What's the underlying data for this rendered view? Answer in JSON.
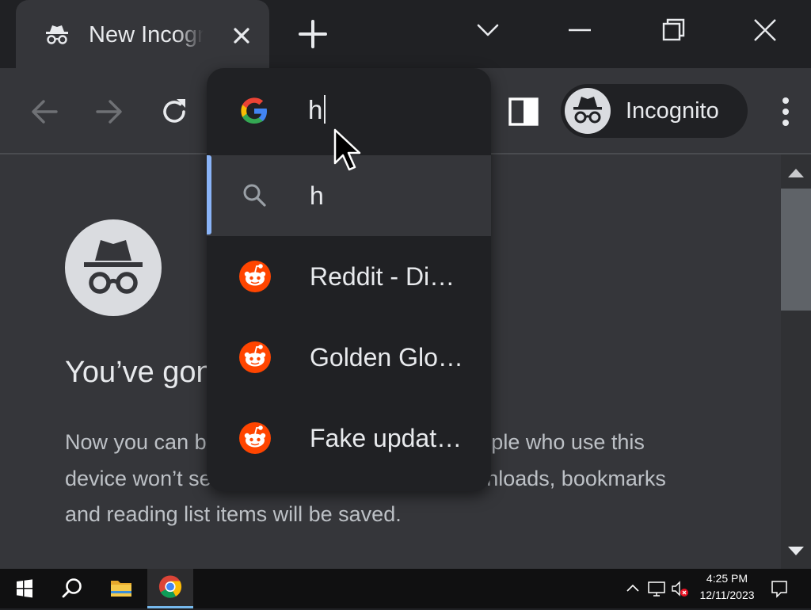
{
  "browser": {
    "tab": {
      "title": "New Incognito Tab"
    },
    "profile": {
      "label": "Incognito"
    }
  },
  "omnibox": {
    "input_value": "h",
    "suggestions": [
      {
        "text": "h",
        "icon": "search-icon",
        "selected": true
      },
      {
        "text": "Reddit - Di…",
        "icon": "reddit-icon"
      },
      {
        "text": "Golden Glo…",
        "icon": "reddit-icon"
      },
      {
        "text": "Fake updat…",
        "icon": "reddit-icon"
      }
    ]
  },
  "page": {
    "heading": "You’ve gone Incognito",
    "paragraph": "Now you can browse privately, and other people who use this device won’t see your activity. However, downloads, bookmarks and reading list items will be saved."
  },
  "taskbar": {
    "time": "4:25 PM",
    "date": "12/11/2023"
  },
  "colors": {
    "frame": "#202124",
    "toolbar": "#35363a",
    "accent": "#8ab4f8",
    "reddit": "#ff4500"
  }
}
